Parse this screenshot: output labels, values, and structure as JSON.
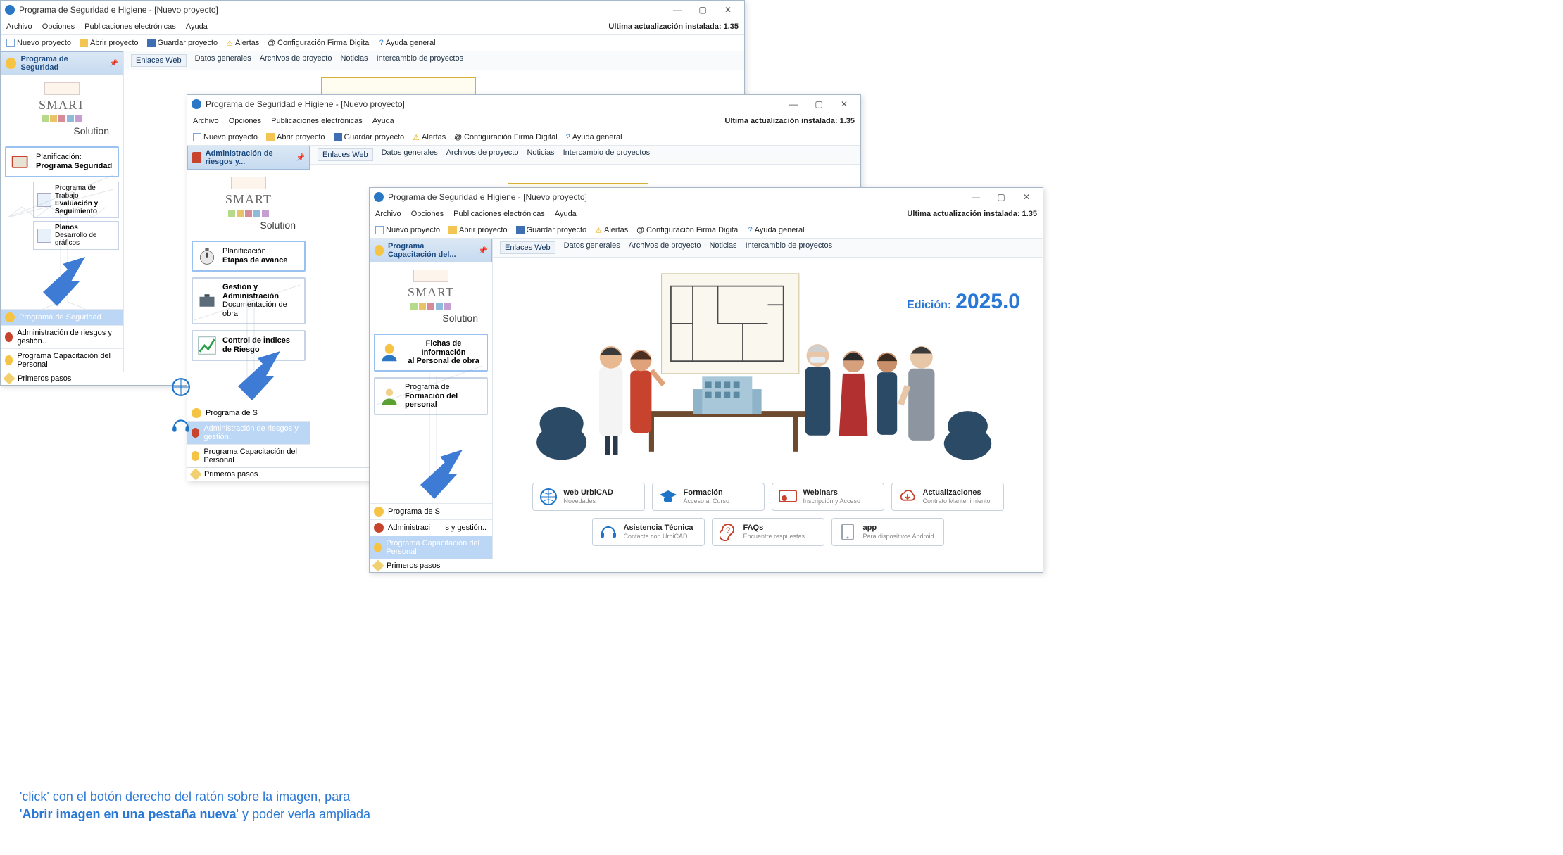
{
  "app_title": "Programa de Seguridad e Higiene - [Nuevo proyecto]",
  "update_text": "Ultima actualización instalada: 1.35",
  "menus": [
    "Archivo",
    "Opciones",
    "Publicaciones electrónicas",
    "Ayuda"
  ],
  "toolbar": {
    "new": "Nuevo proyecto",
    "open": "Abrir proyecto",
    "save": "Guardar proyecto",
    "alerts": "Alertas",
    "sig": "Configuración Firma Digital",
    "help": "Ayuda general"
  },
  "tabs": [
    "Enlaces Web",
    "Datos generales",
    "Archivos de proyecto",
    "Noticias",
    "Intercambio de proyectos"
  ],
  "logo": {
    "smart": "SMART",
    "solution": "Solution"
  },
  "statusbar": "Primeros pasos",
  "nav": {
    "seguridad": "Programa de Seguridad",
    "riesgos": "Administración de riesgos y gestión..",
    "capacit": "Programa Capacitación del Personal",
    "riesgos_short": "Administraci",
    "riesgos_tail": "s y gestión..",
    "seguridad_short": "Programa de S"
  },
  "win1": {
    "side_header": "Programa de Seguridad",
    "card": {
      "l1": "Planificación:",
      "l2": "Programa Seguridad"
    },
    "sub1": {
      "l1": "Programa de Trabajo",
      "l2": "Evaluación y Seguimiento"
    },
    "sub2": {
      "l1": "Planos",
      "l2": "Desarrollo de gráficos"
    }
  },
  "win2": {
    "side_header": "Administración de riesgos y...",
    "card1": {
      "l1": "Planificación",
      "l2": "Etapas de avance"
    },
    "card2": {
      "l1": "Gestión y",
      "l2": "Administración",
      "l3": "Documentación de obra"
    },
    "card3": {
      "l1": "Control de Índices",
      "l2": "de Riesgo"
    }
  },
  "win3": {
    "side_header": "Programa Capacitación del...",
    "card1": {
      "l1": "Fichas de Información",
      "l2": "al Personal de obra"
    },
    "card2": {
      "l1": "Programa de",
      "l2": "Formación del personal"
    }
  },
  "edition": {
    "pre": "Edición:",
    "ver": "2025.0"
  },
  "links": {
    "row1": [
      {
        "t": "web UrbiCAD",
        "s": "Novedades"
      },
      {
        "t": "Formación",
        "s": "Acceso al Curso"
      },
      {
        "t": "Webinars",
        "s": "Inscripción y Acceso"
      },
      {
        "t": "Actualizaciones",
        "s": "Contrato Mantenimiento"
      }
    ],
    "row2": [
      {
        "t": "Asistencia Técnica",
        "s": "Contacte con UrbiCAD"
      },
      {
        "t": "FAQs",
        "s": "Encuentre respuestas"
      },
      {
        "t": "app",
        "s": "Para dispositivos Android"
      }
    ]
  },
  "hint": {
    "l1": "'click' con el botón derecho del ratón sobre la imagen, para",
    "l2_pre": "'",
    "l2_b": "Abrir imagen en una pestaña nueva",
    "l2_post": "' y poder verla ampliada"
  }
}
